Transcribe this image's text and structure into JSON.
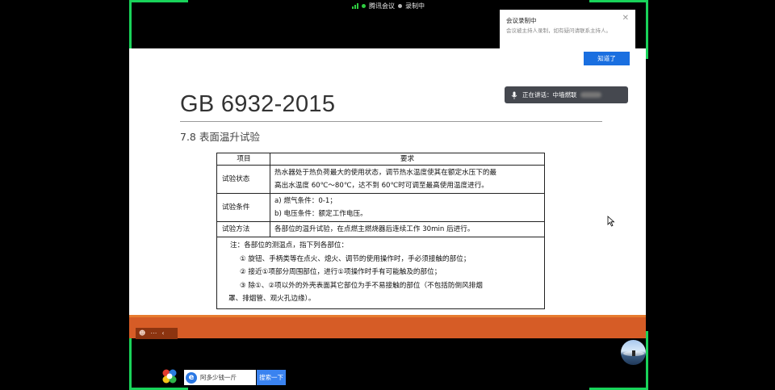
{
  "meeting": {
    "app_name": "腾讯会议",
    "recording_label": "录制中"
  },
  "slide": {
    "doc_title": "GB 6932-2015",
    "section_title": "7.8 表面温升试验",
    "table": {
      "headers": [
        "项目",
        "要求"
      ],
      "rows": [
        {
          "item": "试验状态",
          "lines": [
            "热水器处于热负荷最大的使用状态，调节热水温度使其在额定水压下的最",
            "高出水温度 60℃～80℃，达不到 60℃时可调至最高使用温度进行。"
          ]
        },
        {
          "item": "试验条件",
          "lines": [
            "a) 燃气条件：0-1；",
            "b) 电压条件：额定工作电压。"
          ]
        },
        {
          "item": "试验方法",
          "lines": [
            "各部位的温升试验，在点燃主燃烧器后连续工作 30min 后进行。"
          ]
        }
      ],
      "note_lines": [
        "注：各部位的测温点，指下列各部位：",
        "①  旋钮、手柄类等在点火、熄火、调节的使用操作时，手必须接触的部位；",
        "②  接近①项部分周围部位，进行①项操作时手有可能触及的部位；",
        "③  除①、②项以外的外壳表面其它部位为手不易接触的部位（不包括防倒风排烟",
        "罩、排烟管、观火孔边缘）。"
      ]
    }
  },
  "notification": {
    "title": "会议录制中",
    "body": "会议被主持人录制，如有疑问请联系主持人。",
    "button": "知道了"
  },
  "speaker": {
    "label": "正在讲话：",
    "name": "中墙燃联"
  },
  "taskbar": {
    "input_value": "阿多少钱一斤",
    "search_button": "搜索一下"
  },
  "icons": {
    "close": "close-icon",
    "mic": "mic-icon",
    "signal": "signal-icon",
    "ie": "ie-icon",
    "cursor": "cursor-icon"
  },
  "colors": {
    "accent_green": "#19d35a",
    "notice_button": "#1a6fe0",
    "slide_bar": "#d65c26",
    "search_button": "#3a83f0"
  }
}
